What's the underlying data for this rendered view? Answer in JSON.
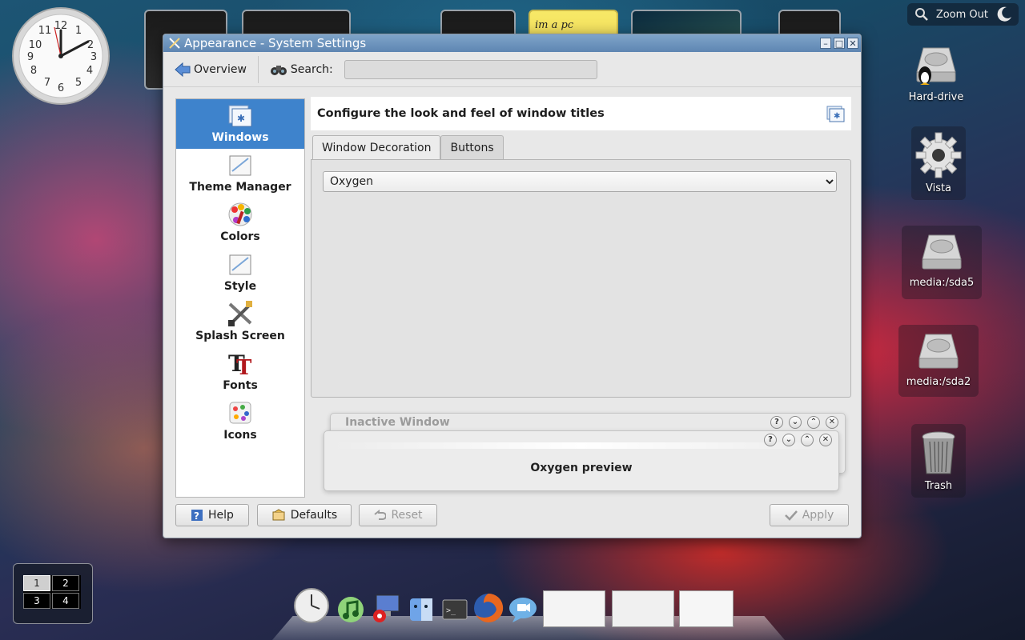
{
  "desktop": {
    "zoom_out_label": "Zoom Out",
    "sticky_note_text": "im a pc",
    "icons": [
      {
        "label": "Hard-drive",
        "icon": "hard-drive-tux-icon"
      },
      {
        "label": "Vista",
        "icon": "gear-icon"
      },
      {
        "label": "media:/sda5",
        "icon": "hard-drive-icon"
      },
      {
        "label": "media:/sda2",
        "icon": "hard-drive-icon"
      },
      {
        "label": "Trash",
        "icon": "trash-icon"
      }
    ],
    "pager": [
      "1",
      "2",
      "3",
      "4"
    ],
    "active_desktop": "1",
    "dock_items": [
      "clock-icon",
      "music-icon",
      "computer-icon",
      "finder-icon",
      "terminal-icon",
      "firefox-icon",
      "chat-icon",
      "firefox-window-thumb",
      "browser-window-thumb",
      "settings-window-thumb"
    ]
  },
  "window": {
    "title": "Appearance - System Settings",
    "toolbar": {
      "overview_label": "Overview",
      "search_label": "Search:",
      "search_value": ""
    },
    "categories": [
      {
        "label": "Windows",
        "active": true
      },
      {
        "label": "Theme Manager",
        "active": false
      },
      {
        "label": "Colors",
        "active": false
      },
      {
        "label": "Style",
        "active": false
      },
      {
        "label": "Splash Screen",
        "active": false
      },
      {
        "label": "Fonts",
        "active": false
      },
      {
        "label": "Icons",
        "active": false
      }
    ],
    "heading": "Configure the look and feel of window titles",
    "tabs": [
      {
        "label": "Window Decoration",
        "active": true
      },
      {
        "label": "Buttons",
        "active": false
      }
    ],
    "decoration_selected": "Oxygen",
    "preview": {
      "inactive_title": "Inactive Window",
      "active_body": "Oxygen preview"
    },
    "buttons": {
      "help": "Help",
      "defaults": "Defaults",
      "reset": "Reset",
      "apply": "Apply"
    }
  },
  "colors": {
    "selection": "#3e83cc",
    "titlebar": "#6b91bc"
  }
}
